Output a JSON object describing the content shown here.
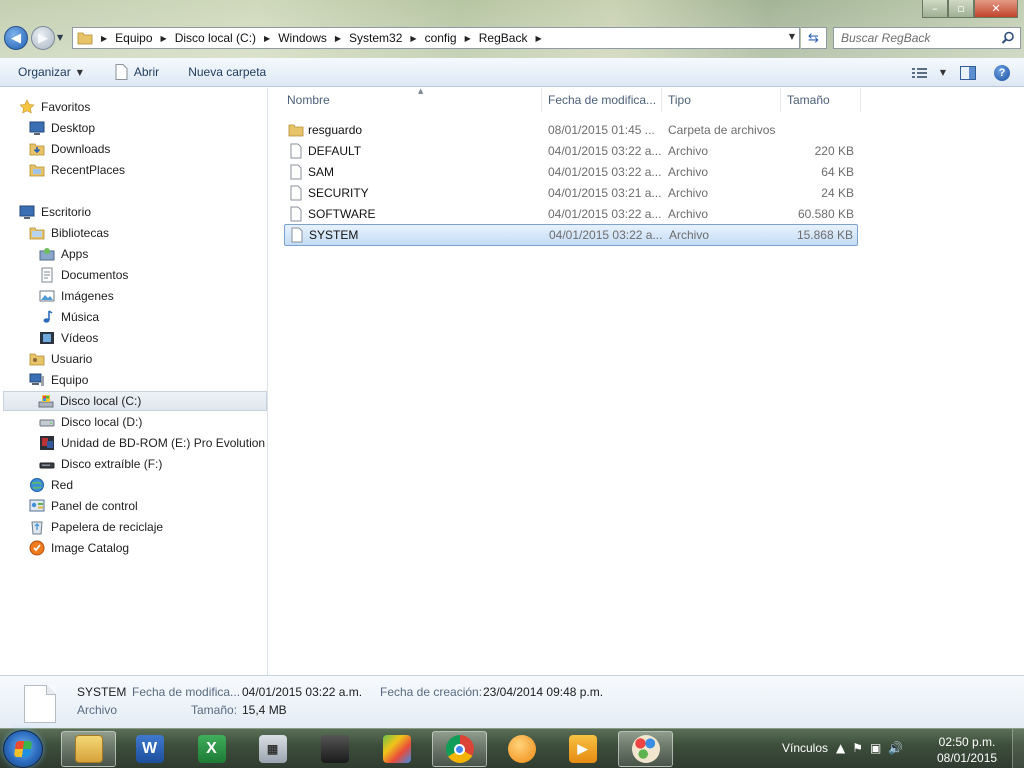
{
  "address": {
    "crumbs": [
      "Equipo",
      "Disco local (C:)",
      "Windows",
      "System32",
      "config",
      "RegBack"
    ]
  },
  "search": {
    "placeholder": "Buscar RegBack"
  },
  "toolbar": {
    "organize": "Organizar",
    "open": "Abrir",
    "new_folder": "Nueva carpeta"
  },
  "nav": {
    "favorites": "Favoritos",
    "desktop": "Desktop",
    "downloads": "Downloads",
    "recent": "RecentPlaces",
    "escritorio": "Escritorio",
    "libraries": "Bibliotecas",
    "apps": "Apps",
    "documents": "Documentos",
    "images": "Imágenes",
    "music": "Música",
    "videos": "Vídeos",
    "user": "Usuario",
    "computer": "Equipo",
    "disk_c": "Disco local (C:)",
    "disk_d": "Disco local (D:)",
    "bd_rom": "Unidad de BD-ROM (E:) Pro Evolution S",
    "removable": "Disco extraíble (F:)",
    "network": "Red",
    "control_panel": "Panel de control",
    "recycle": "Papelera de reciclaje",
    "image_catalog": "Image Catalog"
  },
  "columns": {
    "name": "Nombre",
    "date": "Fecha de modifica...",
    "type": "Tipo",
    "size": "Tamaño"
  },
  "files": [
    {
      "name": "resguardo",
      "date": "08/01/2015 01:45 ...",
      "type": "Carpeta de archivos",
      "size": "",
      "kind": "folder"
    },
    {
      "name": "DEFAULT",
      "date": "04/01/2015 03:22 a...",
      "type": "Archivo",
      "size": "220 KB",
      "kind": "file"
    },
    {
      "name": "SAM",
      "date": "04/01/2015 03:22 a...",
      "type": "Archivo",
      "size": "64 KB",
      "kind": "file"
    },
    {
      "name": "SECURITY",
      "date": "04/01/2015 03:21 a...",
      "type": "Archivo",
      "size": "24 KB",
      "kind": "file"
    },
    {
      "name": "SOFTWARE",
      "date": "04/01/2015 03:22 a...",
      "type": "Archivo",
      "size": "60.580 KB",
      "kind": "file"
    },
    {
      "name": "SYSTEM",
      "date": "04/01/2015 03:22 a...",
      "type": "Archivo",
      "size": "15.868 KB",
      "kind": "file"
    }
  ],
  "details": {
    "name": "SYSTEM",
    "type": "Archivo",
    "modified_label": "Fecha de modifica...",
    "modified_value": "04/01/2015 03:22 a.m.",
    "size_label": "Tamaño:",
    "size_value": "15,4 MB",
    "created_label": "Fecha de creación:",
    "created_value": "23/04/2014 09:48 p.m."
  },
  "taskbar": {
    "tray_label": "Vínculos",
    "time": "02:50 p.m.",
    "date": "08/01/2015"
  }
}
